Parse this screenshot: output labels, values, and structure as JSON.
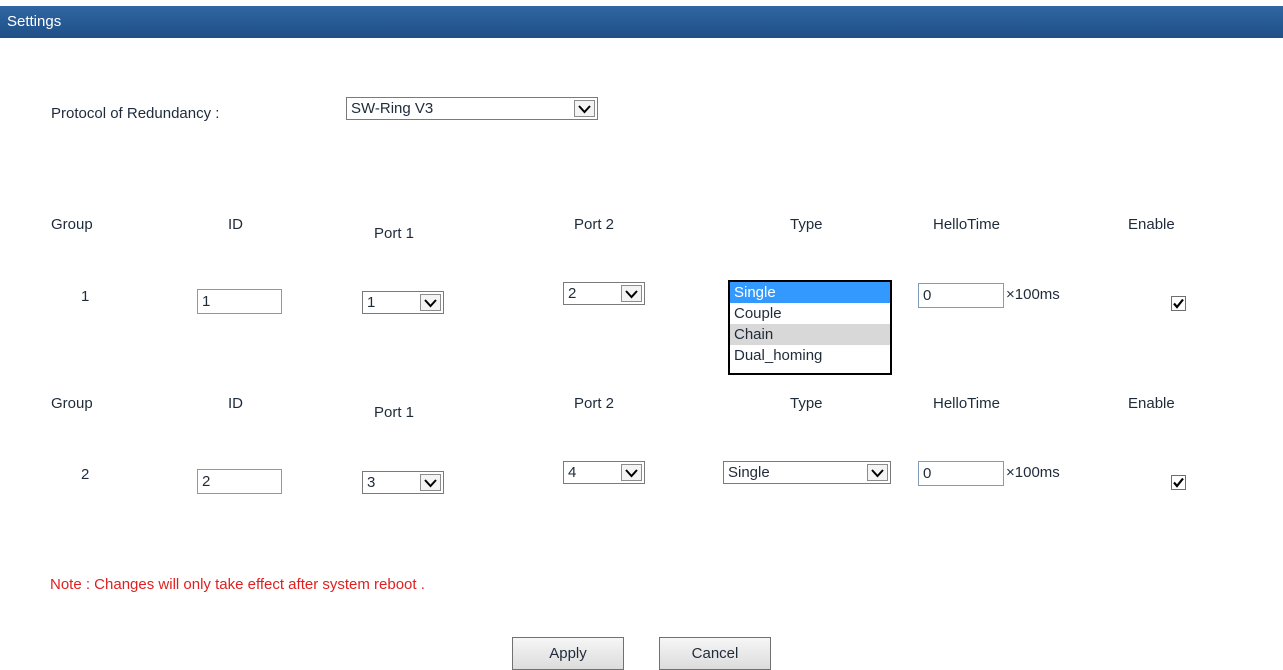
{
  "header": {
    "title": "Settings"
  },
  "protocol": {
    "label": "Protocol of Redundancy :",
    "value": "SW-Ring V3"
  },
  "columns": {
    "group": "Group",
    "id": "ID",
    "port1": "Port 1",
    "port2": "Port 2",
    "type": "Type",
    "hellotime": "HelloTime",
    "enable": "Enable"
  },
  "groups": [
    {
      "number": "1",
      "id": "1",
      "port1": "1",
      "port2": "2",
      "type": "Single",
      "hellotime": "0",
      "unit": "×100ms",
      "enabled": true,
      "type_open": true
    },
    {
      "number": "2",
      "id": "2",
      "port1": "3",
      "port2": "4",
      "type": "Single",
      "hellotime": "0",
      "unit": "×100ms",
      "enabled": true,
      "type_open": false
    }
  ],
  "type_options": [
    "Single",
    "Couple",
    "Chain",
    "Dual_homing"
  ],
  "note": "Note : Changes will only take effect after system reboot .",
  "buttons": {
    "apply": "Apply",
    "cancel": "Cancel"
  },
  "colors": {
    "header_bg": "#1f4f86",
    "selected_option": "#3399ff",
    "hover_option": "#d8d8d8",
    "note": "#e02020"
  }
}
